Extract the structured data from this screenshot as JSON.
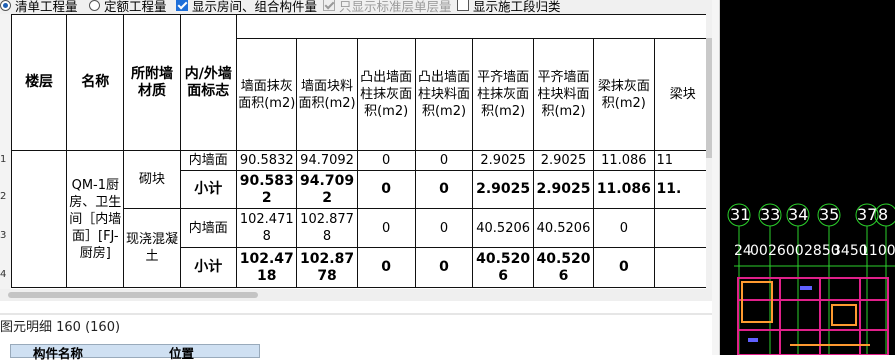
{
  "options": [
    {
      "label": "清单工程量",
      "type": "radio",
      "checked": true,
      "disabled": false
    },
    {
      "label": "定额工程量",
      "type": "radio",
      "checked": false,
      "disabled": false
    },
    {
      "label": "显示房间、组合构件量",
      "type": "checkbox",
      "checked": true,
      "disabled": false
    },
    {
      "label": "只显示标准层单层量",
      "type": "checkbox",
      "checked": true,
      "disabled": true
    },
    {
      "label": "显示施工段归类",
      "type": "checkbox",
      "checked": false,
      "disabled": false
    }
  ],
  "table": {
    "headers": {
      "floor": "楼层",
      "name": "名称",
      "material": "所附墙材质",
      "side": "内/外墙面标志",
      "qty": [
        "墙面抹灰面积(m2)",
        "墙面块料面积(m2)",
        "凸出墙面柱抹灰面积(m2)",
        "凸出墙面柱块料面积(m2)",
        "平齐墙面柱抹灰面积(m2)",
        "平齐墙面柱块料面积(m2)",
        "梁抹灰面积(m2)",
        "梁块"
      ]
    },
    "row_numbers": [
      "1",
      "2",
      "3",
      "4"
    ],
    "name_cell": "QM-1厨房、卫生间［内墙面］[FJ-厨房]",
    "groups": [
      {
        "material": "砌块",
        "rows": [
          {
            "side": "内墙面",
            "subtotal": false,
            "values": [
              "90.5832",
              "94.7092",
              "0",
              "0",
              "2.9025",
              "2.9025",
              "11.086",
              "11"
            ]
          },
          {
            "side": "小计",
            "subtotal": true,
            "values": [
              "90.5832",
              "94.7092",
              "0",
              "0",
              "2.9025",
              "2.9025",
              "11.086",
              "11."
            ]
          }
        ]
      },
      {
        "material": "现浇混凝土",
        "rows": [
          {
            "side": "内墙面",
            "subtotal": false,
            "values": [
              "102.4718",
              "102.8778",
              "0",
              "0",
              "40.5206",
              "40.5206",
              "0",
              ""
            ]
          },
          {
            "side": "小计",
            "subtotal": true,
            "values": [
              "102.4718",
              "102.8778",
              "0",
              "0",
              "40.5206",
              "40.5206",
              "0",
              ""
            ]
          }
        ]
      }
    ]
  },
  "detail_panel": {
    "title": "图元明细  160 (160)",
    "col_name": "构件名称",
    "col_pos": "位置"
  },
  "cad": {
    "axis_labels": [
      "31",
      "33",
      "34",
      "35",
      "37",
      "8"
    ],
    "dim_labels": [
      "24",
      "00",
      "2600",
      "2850",
      "3450",
      "1100"
    ],
    "colors": {
      "axis": "#2bd12b",
      "wall": "#e0208a",
      "highlight": "#ff9a30",
      "dim": "#ffffff"
    }
  }
}
